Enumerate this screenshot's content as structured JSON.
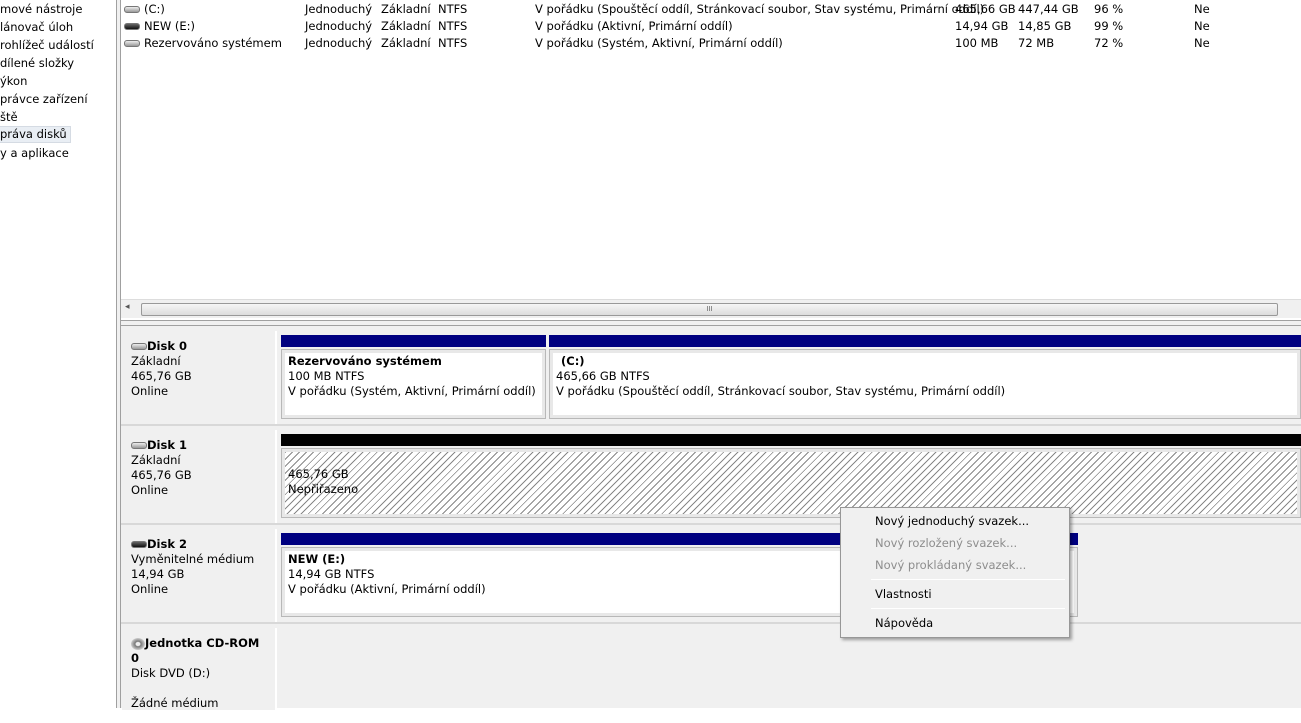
{
  "nav": {
    "items": [
      "mové nástroje",
      "lánovač úloh",
      "rohlížeč událostí",
      "dílené složky",
      "ýkon",
      "právce zařízení",
      "ště",
      "práva disků",
      "y a aplikace"
    ],
    "selected_index": 7
  },
  "volumes": [
    {
      "name": "(C:)",
      "icon": "hdd-icon",
      "layout": "Jednoduchý",
      "type": "Základní",
      "fs": "NTFS",
      "status": "V pořádku (Spouštěcí oddíl, Stránkovací soubor, Stav systému, Primární oddíl)",
      "capacity": "465,66 GB",
      "free": "447,44 GB",
      "pct_free": "96 %",
      "fault": "Ne"
    },
    {
      "name": "NEW (E:)",
      "icon": "removable-drive-icon",
      "layout": "Jednoduchý",
      "type": "Základní",
      "fs": "NTFS",
      "status": "V pořádku (Aktivní, Primární oddíl)",
      "capacity": "14,94 GB",
      "free": "14,85 GB",
      "pct_free": "99 %",
      "fault": "Ne"
    },
    {
      "name": "Rezervováno systémem",
      "icon": "hdd-icon",
      "layout": "Jednoduchý",
      "type": "Základní",
      "fs": "NTFS",
      "status": "V pořádku (Systém, Aktivní, Primární oddíl)",
      "capacity": "100 MB",
      "free": "72 MB",
      "pct_free": "72 %",
      "fault": "Ne"
    }
  ],
  "scroll_grip": "III",
  "disks": [
    {
      "name": "Disk 0",
      "type": "Základní",
      "size": "465,76 GB",
      "state": "Online",
      "partitions": [
        {
          "title": "Rezervováno systémem",
          "size": "100 MB NTFS",
          "status": "V pořádku (Systém, Aktivní, Primární oddíl)"
        },
        {
          "title": "(C:)",
          "size": "465,66 GB NTFS",
          "status": "V pořádku (Spouštěcí oddíl, Stránkovací soubor, Stav systému, Primární oddíl)"
        }
      ]
    },
    {
      "name": "Disk 1",
      "type": "Základní",
      "size": "465,76 GB",
      "state": "Online",
      "partitions": [
        {
          "size": "465,76 GB",
          "status": "Nepřiřazeno"
        }
      ]
    },
    {
      "name": "Disk 2",
      "type": "Vyměnitelné médium",
      "size": "14,94 GB",
      "state": "Online",
      "partitions": [
        {
          "title": "NEW  (E:)",
          "size": "14,94 GB NTFS",
          "status": "V pořádku (Aktivní, Primární oddíl)"
        }
      ]
    },
    {
      "name": "Jednotka CD-ROM 0",
      "type": "Disk DVD (D:)",
      "state": "Žádné médium"
    }
  ],
  "context_menu": {
    "items": [
      {
        "label": "Nový jednoduchý svazek...",
        "enabled": true
      },
      {
        "label": "Nový rozložený svazek...",
        "enabled": false
      },
      {
        "label": "Nový prokládaný svazek...",
        "enabled": false
      },
      {
        "label": "Vlastnosti",
        "enabled": true
      },
      {
        "label": "Nápověda",
        "enabled": true
      }
    ]
  },
  "colors": {
    "primary_partition": "#000080",
    "unallocated": "#000000"
  }
}
